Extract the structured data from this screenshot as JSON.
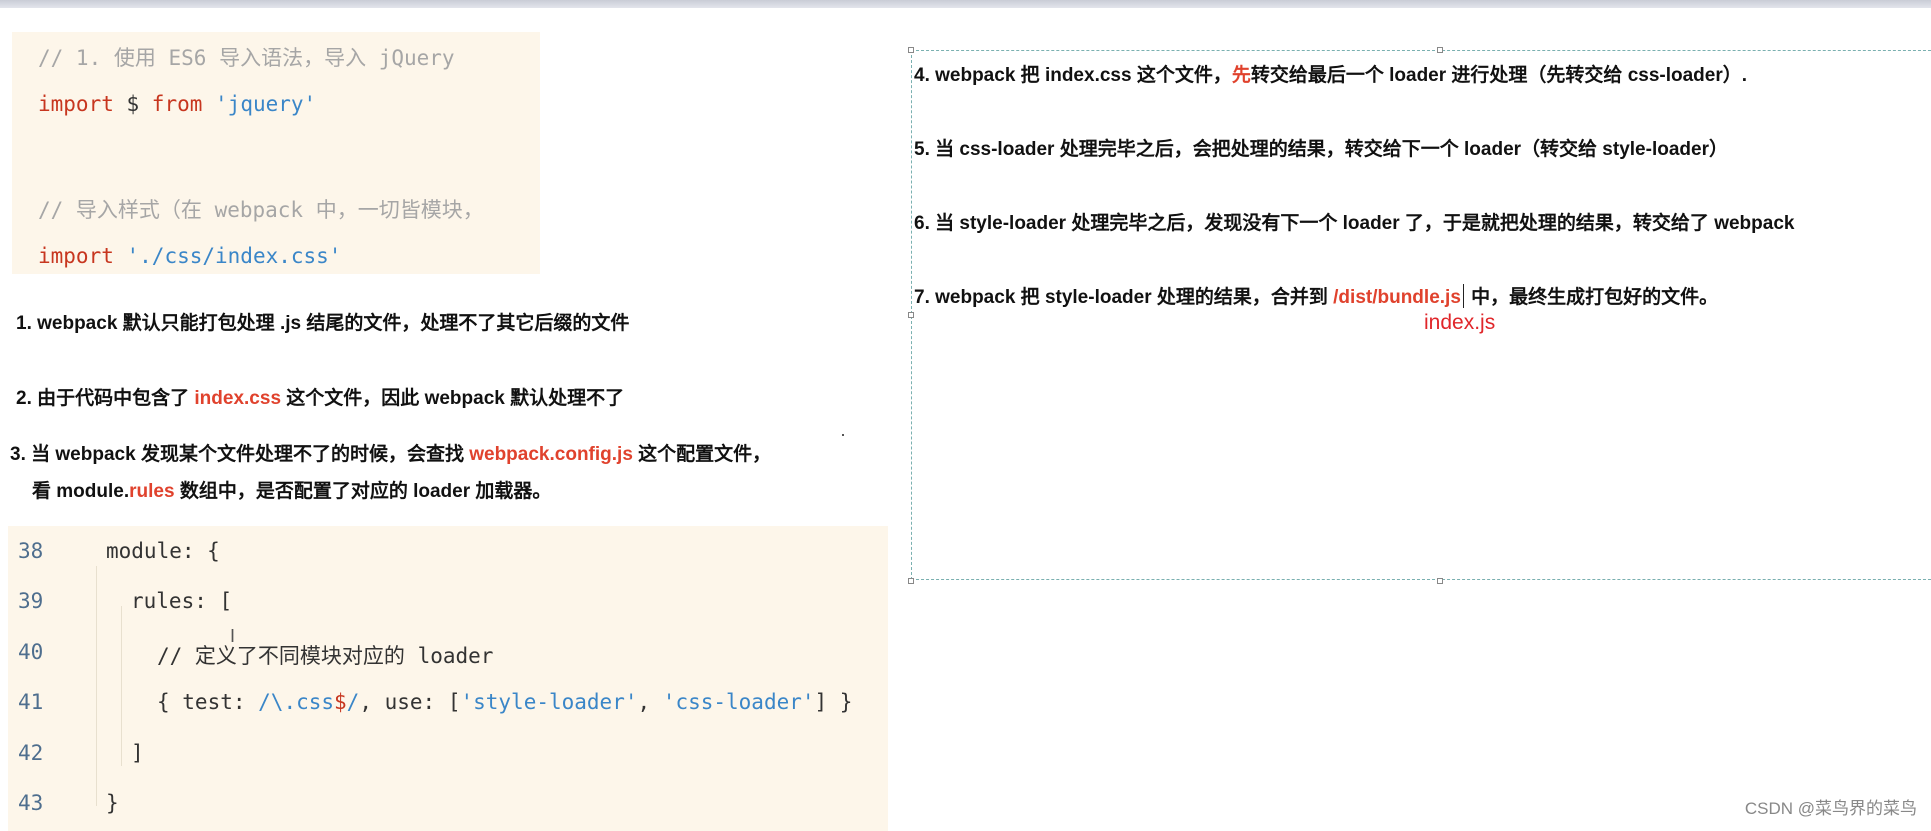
{
  "top_code": {
    "line1_comment": "// 1. 使用 ES6 导入语法，导入 jQuery",
    "line2": {
      "kw1": "import",
      "mid": " $ ",
      "kw2": "from",
      "str": "'jquery'"
    },
    "line3_comment": "// 导入样式（在 webpack 中，一切皆模块，",
    "line4": {
      "kw": "import",
      "str": "'./css/index.css'"
    }
  },
  "notes_left": {
    "n1": "1. webpack 默认只能打包处理 .js 结尾的文件，处理不了其它后缀的文件",
    "n2": {
      "pre": "2. 由于代码中包含了 ",
      "hl": "index.css",
      "post": " 这个文件，因此 webpack 默认处理不了"
    },
    "n3a": {
      "pre": "3. 当 webpack 发现某个文件处理不了的时候，会查找 ",
      "hl": "webpack.config.js",
      "post": " 这个配置文件，"
    },
    "n3b": {
      "pre": "看 module.",
      "hl": "rules",
      "post": " 数组中，是否配置了对应的 loader 加载器。"
    }
  },
  "bottom_code": {
    "line_numbers": [
      "38",
      "39",
      "40",
      "41",
      "42",
      "43"
    ],
    "l38": "module: {",
    "l39": "rules: [",
    "l40": "// 定义了不同模块对应的 loader",
    "l41": {
      "a": "{ test: ",
      "re1": "/\\.css",
      "re2": "$",
      "re3": "/",
      "b": ", use: [",
      "s1": "'style-loader'",
      "c": ", ",
      "s2": "'css-loader'",
      "d": "] }"
    },
    "l42": "]",
    "l43": "}"
  },
  "notes_right": {
    "n4": {
      "pre": "4. webpack 把 index.css 这个文件，",
      "hl": "先",
      "post": "转交给最后一个 loader 进行处理（先转交给 css-loader）."
    },
    "n5": "5. 当 css-loader 处理完毕之后，会把处理的结果，转交给下一个 loader（转交给 style-loader）",
    "n6": "6. 当 style-loader 处理完毕之后，发现没有下一个 loader 了，于是就把处理的结果，转交给了 webpack",
    "n7": {
      "pre": "7. webpack 把 style-loader 处理的结果，合并到 ",
      "hl": "/dist/bundle.js",
      "post": " 中，最终生成打包好的文件。"
    },
    "annotation": "index.js"
  },
  "watermark": "CSDN @菜鸟界的菜鸟",
  "colors": {
    "highlight": "#e0422d",
    "code_bg": "#fdf6ea",
    "annotation": "#e0262a"
  }
}
